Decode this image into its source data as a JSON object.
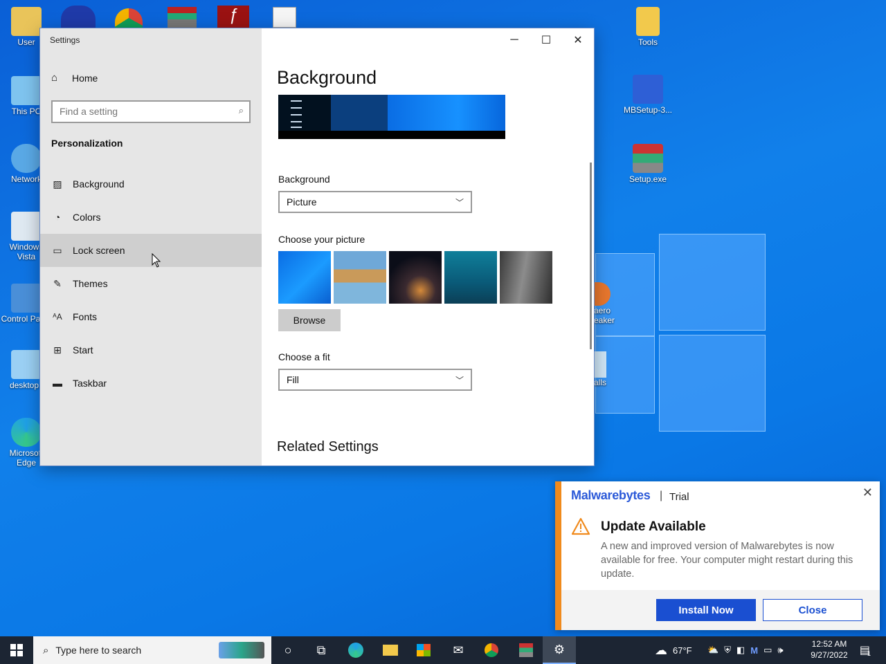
{
  "desktop": {
    "icons_left": [
      {
        "label": "User",
        "icon": "user-folder-icon"
      },
      {
        "label": "This PC",
        "icon": "computer-icon"
      },
      {
        "label": "Network",
        "icon": "network-icon"
      },
      {
        "label": "Windows Vista",
        "icon": "recycle-bin-icon"
      },
      {
        "label": "Control Panel",
        "icon": "control-panel-icon"
      },
      {
        "label": "desktop.i",
        "icon": "settings-file-icon"
      },
      {
        "label": "Microsoft Edge",
        "icon": "edge-icon"
      }
    ],
    "icons_right": [
      {
        "label": "Tools",
        "icon": "folder-icon"
      },
      {
        "label": "MBSetup-3...",
        "icon": "malwarebytes-setup-icon"
      },
      {
        "label": "Setup.exe",
        "icon": "winrar-installer-icon"
      }
    ],
    "partial_labels": [
      "aero",
      "eaker",
      "alls"
    ]
  },
  "settings": {
    "window_title": "Settings",
    "home_label": "Home",
    "search_placeholder": "Find a setting",
    "section_title": "Personalization",
    "nav_items": [
      {
        "label": "Background",
        "icon": "picture-icon"
      },
      {
        "label": "Colors",
        "icon": "palette-icon"
      },
      {
        "label": "Lock screen",
        "icon": "lock-screen-icon"
      },
      {
        "label": "Themes",
        "icon": "themes-brush-icon"
      },
      {
        "label": "Fonts",
        "icon": "fonts-icon"
      },
      {
        "label": "Start",
        "icon": "start-grid-icon"
      },
      {
        "label": "Taskbar",
        "icon": "taskbar-icon"
      }
    ],
    "hovered_item": "Lock screen",
    "page_title": "Background",
    "background_label": "Background",
    "background_value": "Picture",
    "choose_picture_label": "Choose your picture",
    "browse_label": "Browse",
    "fit_label": "Choose a fit",
    "fit_value": "Fill",
    "related_title": "Related Settings"
  },
  "malwarebytes": {
    "brand": "Malwarebytes",
    "separator": "|",
    "tier": "Trial",
    "heading": "Update Available",
    "message": "A new and improved version of Malwarebytes is now available for free. Your computer might restart during this update.",
    "install_label": "Install Now",
    "close_label": "Close",
    "accent_color": "#f08a1c",
    "button_color": "#1a4fd1"
  },
  "taskbar": {
    "search_placeholder": "Type here to search",
    "weather": "67°F",
    "time": "12:52 AM",
    "date": "9/27/2022",
    "notification_count": "1"
  },
  "colors": {
    "desktop_blue": "#0a78e6",
    "taskbar": "#1c2533",
    "nav_pane": "#e6e6e6"
  }
}
